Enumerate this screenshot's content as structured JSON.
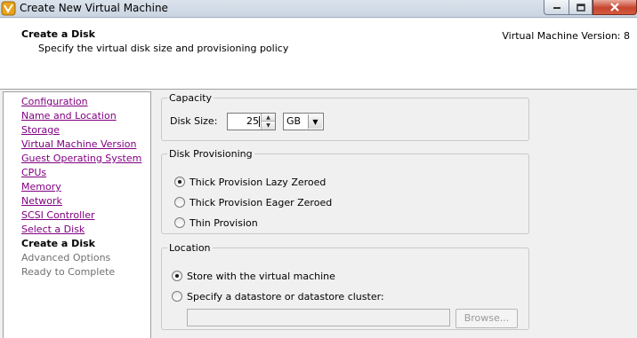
{
  "window": {
    "title": "Create New Virtual Machine",
    "app_icon": "vsphere-logo-icon",
    "controls": [
      "minimize-icon",
      "maximize-icon",
      "close-icon"
    ]
  },
  "header": {
    "title": "Create a Disk",
    "subtitle": "Specify the virtual disk size and provisioning policy",
    "version": "Virtual Machine Version: 8"
  },
  "steps": [
    {
      "label": "Configuration",
      "state": "link"
    },
    {
      "label": "Name and Location",
      "state": "link"
    },
    {
      "label": "Storage",
      "state": "link"
    },
    {
      "label": "Virtual Machine Version",
      "state": "link"
    },
    {
      "label": "Guest Operating System",
      "state": "link"
    },
    {
      "label": "CPUs",
      "state": "link"
    },
    {
      "label": "Memory",
      "state": "link"
    },
    {
      "label": "Network",
      "state": "link"
    },
    {
      "label": "SCSI Controller",
      "state": "link"
    },
    {
      "label": "Select a Disk",
      "state": "link"
    },
    {
      "label": "Create a Disk",
      "state": "current"
    },
    {
      "label": "Advanced Options",
      "state": "future"
    },
    {
      "label": "Ready to Complete",
      "state": "future"
    }
  ],
  "capacity": {
    "legend": "Capacity",
    "disk_size_label": "Disk Size:",
    "disk_size_value": "25",
    "unit_value": "GB"
  },
  "provisioning": {
    "legend": "Disk Provisioning",
    "options": [
      {
        "label": "Thick Provision Lazy Zeroed",
        "checked": true
      },
      {
        "label": "Thick Provision Eager Zeroed",
        "checked": false
      },
      {
        "label": "Thin Provision",
        "checked": false
      }
    ]
  },
  "location": {
    "legend": "Location",
    "options": [
      {
        "label": "Store with the virtual machine",
        "checked": true
      },
      {
        "label": "Specify a datastore or datastore cluster:",
        "checked": false
      }
    ],
    "datastore_value": "",
    "browse_label": "Browse..."
  }
}
